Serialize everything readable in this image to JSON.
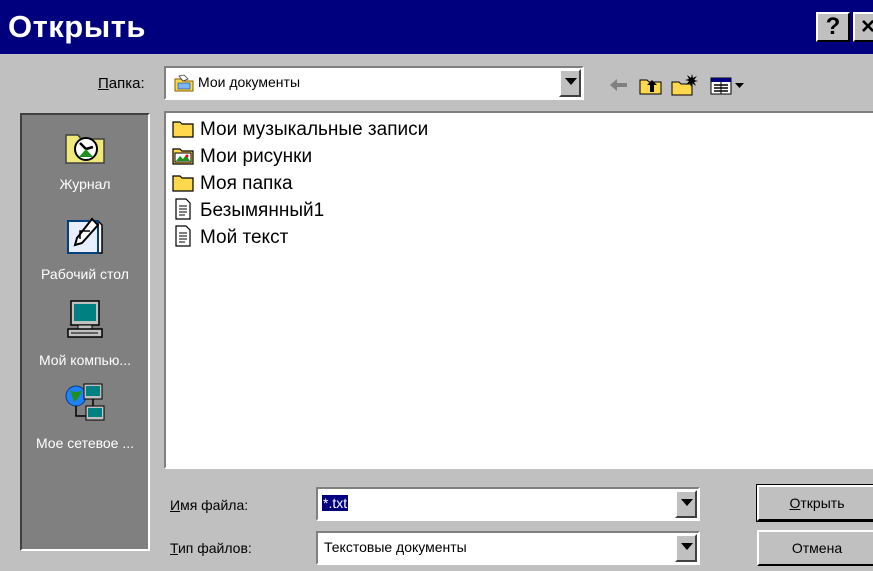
{
  "window": {
    "title": "Открыть",
    "help_glyph": "?",
    "close_glyph": "×"
  },
  "folder": {
    "label_underlined": "П",
    "label_rest": "апка:",
    "value": "Мои документы"
  },
  "toolbar": {
    "icons": [
      "back-arrow-icon",
      "up-one-level-icon",
      "new-folder-icon",
      "views-menu-icon"
    ]
  },
  "places": [
    {
      "label": "Журнал",
      "icon": "history-icon"
    },
    {
      "label": "Рабочий стол",
      "icon": "desktop-icon"
    },
    {
      "label": "Мой компью...",
      "icon": "my-computer-icon"
    },
    {
      "label": "Мое сетевое ...",
      "icon": "network-places-icon"
    }
  ],
  "files": [
    {
      "name": "Мои музыкальные записи",
      "icon": "folder-icon"
    },
    {
      "name": "Мои рисунки",
      "icon": "pictures-folder-icon"
    },
    {
      "name": "Моя папка",
      "icon": "folder-icon"
    },
    {
      "name": "Безымянный1",
      "icon": "text-document-icon"
    },
    {
      "name": "Мой текст",
      "icon": "text-document-icon"
    }
  ],
  "filename": {
    "label_underlined": "И",
    "label_rest": "мя файла:",
    "value": "*.txt"
  },
  "filetype": {
    "label_underlined": "Т",
    "label_rest": "ип файлов:",
    "value": "Текстовые документы"
  },
  "buttons": {
    "open_underlined": "О",
    "open_rest": "ткрыть",
    "cancel": "Отмена"
  },
  "colors": {
    "titlebar": "#00007f",
    "face": "#c0c0c0",
    "places_bg": "#808080",
    "selection": "#00007f"
  }
}
